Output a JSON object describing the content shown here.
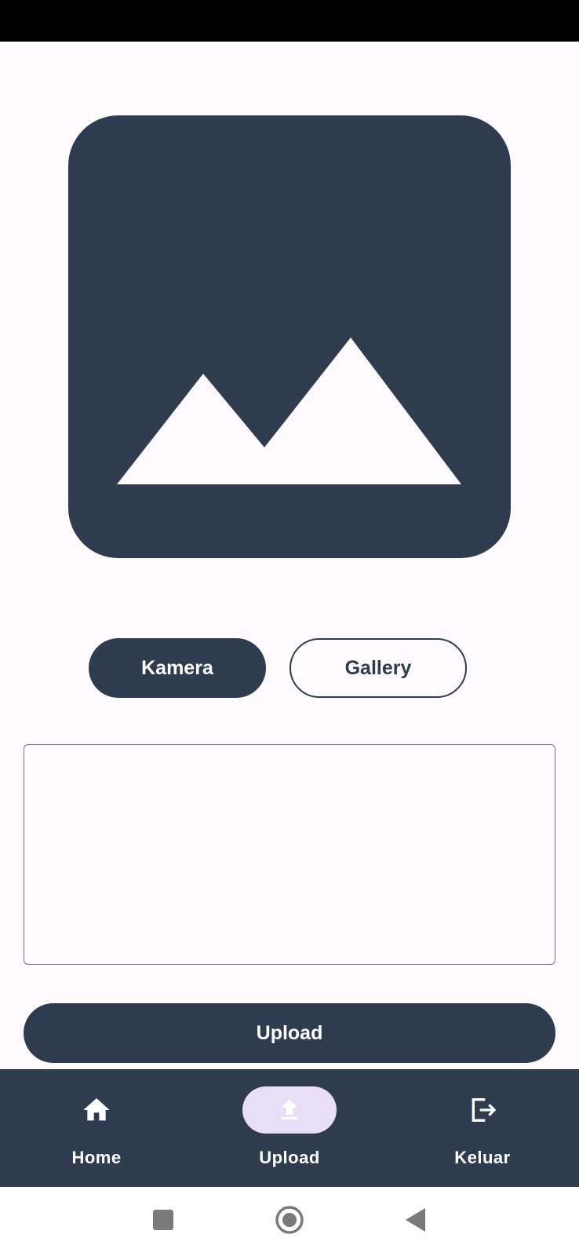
{
  "colors": {
    "primary": "#2f3c4f",
    "background": "#fefafd",
    "nav_active_indicator": "#e8def8",
    "on_primary": "#ffffff"
  },
  "preview": {
    "icon": "image-placeholder-icon"
  },
  "buttons": {
    "camera_label": "Kamera",
    "gallery_label": "Gallery",
    "upload_label": "Upload"
  },
  "description_input": {
    "value": "",
    "placeholder": ""
  },
  "bottom_nav": {
    "items": [
      {
        "label": "Home",
        "icon": "home-icon",
        "active": false
      },
      {
        "label": "Upload",
        "icon": "upload-icon",
        "active": true
      },
      {
        "label": "Keluar",
        "icon": "logout-icon",
        "active": false
      }
    ]
  },
  "system_nav": {
    "icons": [
      "recents-icon",
      "home-circle-icon",
      "back-icon"
    ]
  }
}
